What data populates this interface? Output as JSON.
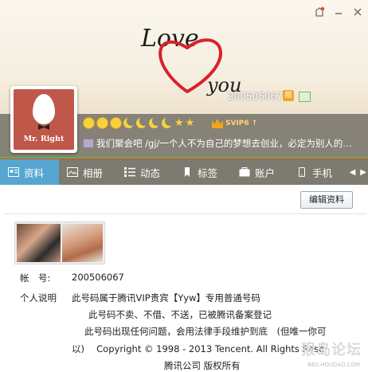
{
  "header": {
    "qq_number": "200506067",
    "vip_badge_text": "靓",
    "art_text_top": "Love",
    "art_text_bottom": "you",
    "avatar_text": "Mr. Right"
  },
  "status_strip": {
    "svip_text": "SVIP6",
    "svip_arrow": "↑",
    "signature": "我们聚会吧 /gj/一个人不为自己的梦想去创业，必定为别人的…"
  },
  "tabs": [
    {
      "label": "资料",
      "icon": "profile-card-icon",
      "active": true
    },
    {
      "label": "相册",
      "icon": "photo-album-icon",
      "active": false
    },
    {
      "label": "动态",
      "icon": "feed-list-icon",
      "active": false
    },
    {
      "label": "标签",
      "icon": "bookmark-tag-icon",
      "active": false
    },
    {
      "label": "账户",
      "icon": "wallet-icon",
      "active": false
    },
    {
      "label": "手机",
      "icon": "mobile-phone-icon",
      "active": false
    }
  ],
  "content": {
    "edit_button": "编辑资料",
    "account_label": "帐　号:",
    "account_value": "200506067",
    "desc_label": "个人说明",
    "desc_line1": "此号码属于腾讯VIP贵宾【Yyw】专用普通号码",
    "desc_line2": "此号码不卖、不借、不送，已被腾讯备案登记",
    "desc_line3": "此号码出现任何问题，会用法律手段维护到底　(但唯一你可",
    "desc_line4": "以)　 Copyright © 1998 - 2013 Tencent. All Rights Rese",
    "desc_line5": "腾讯公司 版权所有"
  },
  "watermark": {
    "main": "猴岛论坛",
    "sub": "BBS.HOUDAO.COM"
  },
  "colors": {
    "strip": "#868277",
    "tab_bar": "#7d7a70",
    "tab_active": "#56a6d1",
    "heart": "#d8222a",
    "avatar_bg": "#c0584a"
  }
}
